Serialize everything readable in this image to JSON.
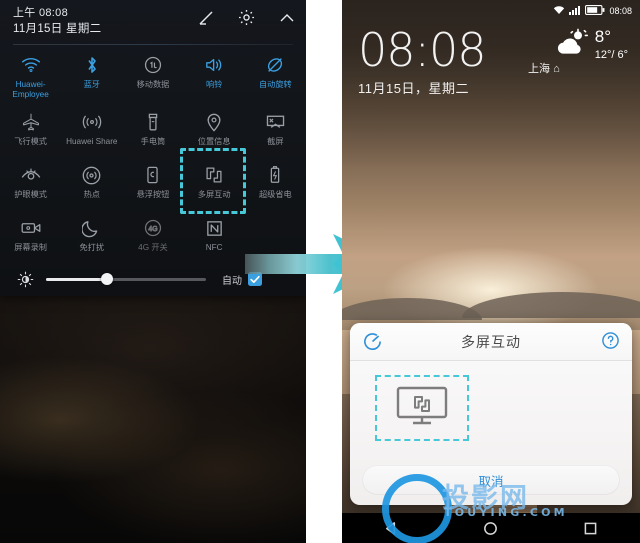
{
  "left_phone": {
    "status": {
      "time": "上午 08:08",
      "date": "11月15日 星期二"
    },
    "header_icons": [
      {
        "name": "edit-icon",
        "glyph": "pencil"
      },
      {
        "name": "settings-icon",
        "glyph": "gear"
      },
      {
        "name": "collapse-icon",
        "glyph": "chevron-up"
      }
    ],
    "toggles": [
      {
        "label": "Huawei-Employee",
        "icon": "wifi-icon",
        "state": "on"
      },
      {
        "label": "蓝牙",
        "icon": "bluetooth-icon",
        "state": "on"
      },
      {
        "label": "移动数据",
        "icon": "mobile-data-icon",
        "state": "off"
      },
      {
        "label": "响铃",
        "icon": "ringer-icon",
        "state": "on"
      },
      {
        "label": "自动旋转",
        "icon": "auto-rotate-icon",
        "state": "on"
      },
      {
        "label": "飞行模式",
        "icon": "airplane-icon",
        "state": "off"
      },
      {
        "label": "Huawei Share",
        "icon": "huawei-share-icon",
        "state": "off"
      },
      {
        "label": "手电筒",
        "icon": "flashlight-icon",
        "state": "off"
      },
      {
        "label": "位置信息",
        "icon": "location-icon",
        "state": "off"
      },
      {
        "label": "截屏",
        "icon": "screenshot-icon",
        "state": "off"
      },
      {
        "label": "护眼模式",
        "icon": "eye-comfort-icon",
        "state": "off"
      },
      {
        "label": "热点",
        "icon": "hotspot-icon",
        "state": "off"
      },
      {
        "label": "悬浮按钮",
        "icon": "floating-dock-icon",
        "state": "off"
      },
      {
        "label": "多屏互动",
        "icon": "multi-screen-icon",
        "state": "off"
      },
      {
        "label": "超级省电",
        "icon": "ultra-power-saving-icon",
        "state": "off"
      },
      {
        "label": "屏幕录制",
        "icon": "screen-record-icon",
        "state": "off"
      },
      {
        "label": "免打扰",
        "icon": "do-not-disturb-icon",
        "state": "off"
      },
      {
        "label": "4G 开关",
        "icon": "four-g-icon",
        "state": "dim"
      },
      {
        "label": "NFC",
        "icon": "nfc-icon",
        "state": "off"
      }
    ],
    "highlight_target": "多屏互动",
    "brightness": {
      "auto_label": "自动",
      "auto_checked": true,
      "value_percent": 38
    }
  },
  "arrow": {
    "name": "flow-arrow",
    "color": "#3fc3d2"
  },
  "right_phone": {
    "status": {
      "time": "08:08",
      "wifi": "wifi-icon",
      "signal": "signal-icon",
      "battery": "battery-icon"
    },
    "lock": {
      "clock": "08:08",
      "city": "上海",
      "date": "11月15日，星期二",
      "weather": {
        "temp": "8°",
        "range": "12°/ 6°",
        "icon": "partly-cloudy-icon"
      }
    },
    "dialog": {
      "title": "多屏互动",
      "left_icon": "refresh-scan-icon",
      "right_icon": "help-icon",
      "device_slot_icon": "monitor-cast-icon",
      "cancel_label": "取消"
    },
    "navbar": [
      {
        "name": "nav-back-icon"
      },
      {
        "name": "nav-home-icon"
      },
      {
        "name": "nav-recents-icon"
      }
    ]
  },
  "watermark": {
    "text": "投影网",
    "sub": "TOUYING.COM"
  },
  "colors": {
    "accent_blue": "#3b9fe0",
    "highlight_cyan": "#46c8d8",
    "inactive_gray": "#8d9198"
  }
}
